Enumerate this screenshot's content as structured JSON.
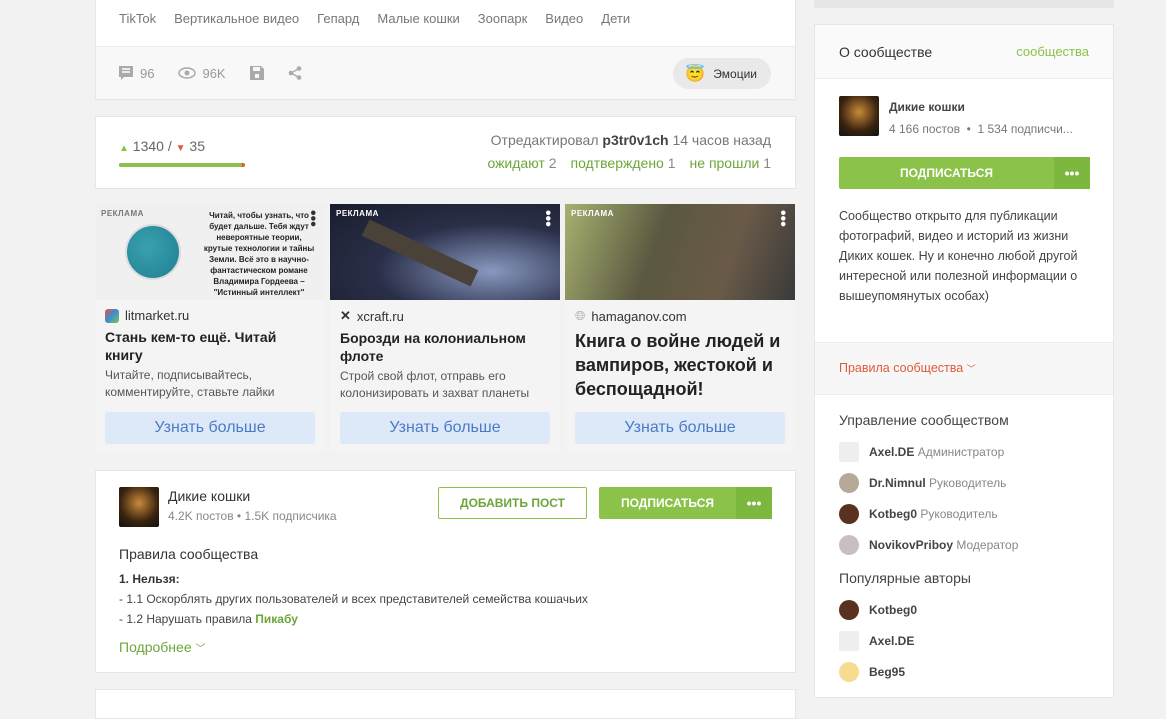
{
  "tags": [
    "TikTok",
    "Вертикальное видео",
    "Гепард",
    "Малые кошки",
    "Зоопарк",
    "Видео",
    "Дети"
  ],
  "post_footer": {
    "comments": "96",
    "views": "96K",
    "emotions_label": "Эмоции"
  },
  "rating": {
    "up": "1340",
    "separator": "/",
    "down": "35",
    "up_fraction": 0.975,
    "edited_prefix": "Отредактировал",
    "editor": "p3tr0v1ch",
    "edited_time": "14 часов назад",
    "pending_label": "ожидают",
    "pending": "2",
    "confirmed_label": "подтверждено",
    "confirmed": "1",
    "rejected_label": "не прошли",
    "rejected": "1"
  },
  "ads": [
    {
      "badge": "РЕКЛАМА",
      "image_text": "Читай, чтобы узнать, что будет дальше. Тебя ждут невероятные теории, крутые технологии и тайны Земли. Всё это в научно-фантастическом романе Владимира Гордеева – \"Истинный интеллект\"",
      "domain": "litmarket.ru",
      "title": "Стань кем-то ещё. Читай книгу",
      "desc": "Читайте, подписывайтесь, комментируйте, ставьте лайки",
      "button": "Узнать больше"
    },
    {
      "badge": "РЕКЛАМА",
      "domain": "xcraft.ru",
      "title": "Борозди на колониальном флоте",
      "desc": "Строй свой флот, отправь его колонизировать и захват планеты",
      "button": "Узнать больше"
    },
    {
      "badge": "РЕКЛАМА",
      "domain": "hamaganov.com",
      "title": "Книга о войне людей и вампиров, жестокой и беспощадной!",
      "button": "Узнать больше"
    }
  ],
  "community_card": {
    "name": "Дикие кошки",
    "stats": "4.2K постов • 1.5K подписчика",
    "add_post": "ДОБАВИТЬ ПОСТ",
    "subscribe": "ПОДПИСАТЬСЯ",
    "more": "•••",
    "rules_title": "Правила сообщества",
    "rule_heading": "1. Нельзя:",
    "rule_1": "- 1.1 Оскорблять других пользователей и всех представителей семейства кошачьих",
    "rule_2_prefix": "- 1.2 Нарушать правила",
    "rule_2_link": "Пикабу",
    "more_link": "Подробнее"
  },
  "sidebar": {
    "title": "О сообществе",
    "link": "сообщества",
    "name": "Дикие кошки",
    "stats": "4 166 постов  •  1 534 подписчи...",
    "subscribe": "ПОДПИСАТЬСЯ",
    "more": "•••",
    "description": "Сообщество открыто для публикации фотографий, видео и историй из жизни Диких кошек. Ну и конечно любой другой интересной или полезной информации о вышеупомянутых особах)",
    "rules_link": "Правила сообщества",
    "management_title": "Управление сообществом",
    "management": [
      {
        "name": "Axel.DE",
        "role": "Администратор"
      },
      {
        "name": "Dr.Nimnul",
        "role": "Руководитель"
      },
      {
        "name": "Kotbeg0",
        "role": "Руководитель"
      },
      {
        "name": "NovikovPriboy",
        "role": "Модератор"
      }
    ],
    "authors_title": "Популярные авторы",
    "authors": [
      {
        "name": "Kotbeg0"
      },
      {
        "name": "Axel.DE"
      },
      {
        "name": "Beg95"
      }
    ]
  },
  "colors": {
    "green": "#8bc34a",
    "red": "#e05a3a",
    "link_green": "#6ca63a"
  }
}
